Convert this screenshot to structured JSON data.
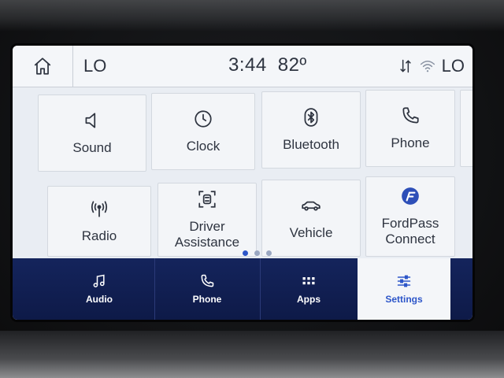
{
  "status_bar": {
    "home_icon": "home-icon",
    "left_temp": "LO",
    "time": "3:44",
    "outside_temp": "82º",
    "right_temp": "LO",
    "icons": [
      "sync-arrows-icon",
      "wifi-icon"
    ]
  },
  "tiles": [
    {
      "label": "Sound",
      "icon": "speaker-icon"
    },
    {
      "label": "Clock",
      "icon": "clock-icon"
    },
    {
      "label": "Bluetooth",
      "icon": "bluetooth-icon"
    },
    {
      "label": "Phone",
      "icon": "phone-icon"
    },
    {
      "label": "Radio",
      "icon": "antenna-icon"
    },
    {
      "label": "Driver\nAssistance",
      "icon": "driver-assist-icon"
    },
    {
      "label": "Vehicle",
      "icon": "car-icon"
    },
    {
      "label": "FordPass\nConnect",
      "icon": "fordpass-icon"
    }
  ],
  "pager": {
    "count": 3,
    "active": 0
  },
  "nav": [
    {
      "label": "Audio",
      "icon": "music-note-icon"
    },
    {
      "label": "Phone",
      "icon": "phone-icon"
    },
    {
      "label": "Apps",
      "icon": "apps-grid-icon"
    },
    {
      "label": "Settings",
      "icon": "sliders-icon",
      "active": true
    }
  ],
  "colors": {
    "nav_background": "#14245c",
    "accent": "#2d56c9",
    "screen_background": "#e9edf3"
  }
}
